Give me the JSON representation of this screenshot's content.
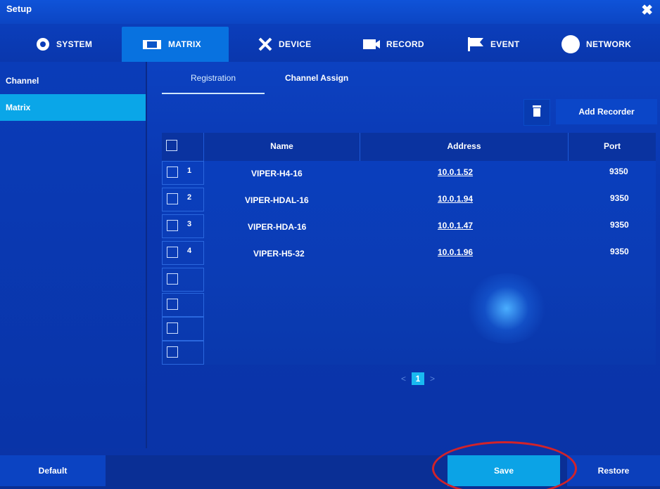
{
  "window": {
    "title": "Setup",
    "close_glyph": "✖"
  },
  "tabs": [
    {
      "label": "SYSTEM",
      "icon": "gear-icon"
    },
    {
      "label": "MATRIX",
      "icon": "monitor-icon"
    },
    {
      "label": "DEVICE",
      "icon": "tools-icon"
    },
    {
      "label": "RECORD",
      "icon": "camera-icon"
    },
    {
      "label": "EVENT",
      "icon": "flag-icon"
    },
    {
      "label": "NETWORK",
      "icon": "globe-icon"
    }
  ],
  "active_tab": "MATRIX",
  "sidebar": {
    "items": [
      {
        "label": "Channel"
      },
      {
        "label": "Matrix"
      }
    ]
  },
  "subtabs": [
    {
      "label": "Registration"
    },
    {
      "label": "Channel Assign"
    }
  ],
  "toolbar": {
    "add_label": "Add Recorder",
    "delete_icon": "trash-icon"
  },
  "table": {
    "headers": {
      "name": "Name",
      "address": "Address",
      "port": "Port"
    },
    "rows": [
      {
        "num": "1",
        "name": "VIPER-H4-16",
        "address": "10.0.1.52",
        "port": "9350"
      },
      {
        "num": "2",
        "name": "VIPER-HDAL-16",
        "address": "10.0.1.94",
        "port": "9350"
      },
      {
        "num": "3",
        "name": "VIPER-HDA-16",
        "address": "10.0.1.47",
        "port": "9350"
      },
      {
        "num": "4",
        "name": "VIPER-H5-32",
        "address": "10.0.1.96",
        "port": "9350"
      }
    ]
  },
  "pager": {
    "prev": "<",
    "page": "1",
    "next": ">"
  },
  "footer": {
    "default_label": "Default",
    "save_label": "Save",
    "restore_label": "Restore"
  },
  "colors": {
    "highlight_ring": "#d1232a",
    "active_item": "#0aa6e8"
  }
}
